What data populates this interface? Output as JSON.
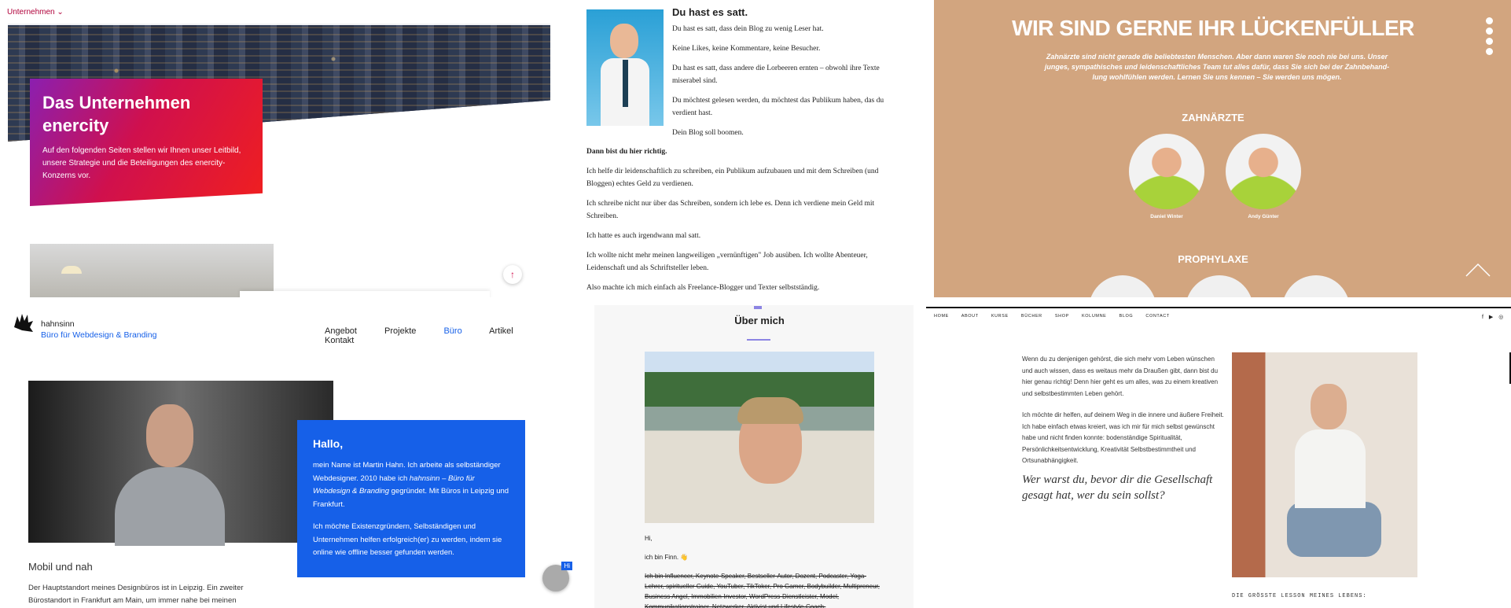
{
  "enercity": {
    "menu_label": "Unternehmen",
    "title_line1": "Das Unternehmen",
    "title_line2": "enercity",
    "text": "Auf den folgenden Seiten stellen wir Ihnen unser Leitbild, unsere Strategie und die Beteiligungen des enercity-Konzerns vor.",
    "accent": "#d0104d"
  },
  "blog": {
    "heading": "Du hast es satt.",
    "intro": [
      "Du hast es satt, dass dein Blog zu wenig Leser hat.",
      "Keine Likes, keine Kommentare, keine Besucher.",
      "Du hast es satt, dass andere die Lorbeeren ernten – obwohl ihre Texte miserabel sind.",
      "Du möchtest gelesen werden, du möchtest das Publikum haben, das du verdient hast.",
      "Dein Blog soll boomen."
    ],
    "bold_line": "Dann bist du hier richtig.",
    "body": [
      "Ich helfe dir leidenschaftlich zu schreiben, ein Publikum aufzubauen und mit dem Schreiben (und Bloggen) echtes Geld zu verdienen.",
      "Ich schreibe nicht nur über das Schreiben, sondern ich lebe es. Denn ich verdiene mein Geld mit Schreiben.",
      "Ich hatte es auch irgendwann mal satt.",
      "Ich wollte nicht mehr meinen langweiligen „vernünftigen\" Job ausüben. Ich wollte Abenteuer, Leidenschaft und als Schriftsteller leben.",
      "Also machte ich mich einfach als Freelance-Blogger und Texter selbstständig."
    ]
  },
  "dental": {
    "title": "WIR SIND GERNE IHR LÜCKENFÜLLER",
    "intro": "Zahnärzte sind nicht gerade die beliebtesten Menschen. Aber dann waren Sie noch nie bei uns. Unser junges, sympathisches und leidenschaftliches Team tut alles dafür, dass Sie sich bei der Zahnbehand-lung wohlfühlen werden. Lernen Sie uns kennen – Sie werden uns mögen.",
    "section1": "ZAHNÄRZTE",
    "dentists": [
      "Daniel Winter",
      "Andy Günter"
    ],
    "section2": "PROPHYLAXE",
    "bg": "#d2a57f"
  },
  "hahnsinn": {
    "brand": "hahnsinn",
    "brand_sub": "Büro für Webdesign & Branding",
    "nav": [
      "Angebot",
      "Projekte",
      "Büro",
      "Artikel",
      "Kontakt"
    ],
    "active_nav": "Büro",
    "greeting": "Hallo,",
    "p1_a": "mein Name ist Martin Hahn. Ich arbeite als selbständiger Webdesigner. 2010 habe ich ",
    "p1_em": "hahnsinn – Büro für Webdesign & Branding",
    "p1_b": " gegründet. Mit Büros in Leipzig und Frankfurt.",
    "p2": "Ich möchte Existenzgründern, Selbständigen und Unternehmen helfen erfolgreich(er) zu werden, indem sie online wie offline besser gefunden werden.",
    "subheading": "Mobil und nah",
    "body": "Der Hauptstandort meines Designbüros ist in Leipzig. Ein zweiter Bürostandort in Frankfurt am Main, um immer nahe bei meinen",
    "chat_badge": "Hi",
    "accent": "#1660e8"
  },
  "ueber": {
    "heading": "Über mich",
    "hi": "Hi,",
    "intro": "ich bin Finn. 👋",
    "struck": "Ich bin Influencer, Keynote-Speaker, Bestseller-Autor, Dozent, Podcaster, Yoga-Lehrer, spiritueller Guide, YouTuber, TikToker, Pro Gamer, Bodybuilder, Multipreneur, Business Angel, Immobilien-Investor, WordPress-Dienstleister, Model, Kommunikationstrainer, Netzwerker, Aktivist und Lifestyle-Coach.",
    "accent": "#8c84e3"
  },
  "coach": {
    "nav": [
      "HOME",
      "ABOUT",
      "KURSE",
      "BÜCHER",
      "SHOP",
      "KOLUMNE",
      "BLOG",
      "CONTACT"
    ],
    "social": [
      "f",
      "▶",
      "◎"
    ],
    "p1": "Wenn du zu denjenigen gehörst, die sich mehr vom Leben wünschen und auch wissen, dass es weitaus mehr da Draußen gibt, dann bist du hier genau richtig! Denn hier geht es um alles, was zu einem kreativen und selbstbestimmten Leben gehört.",
    "p2": "Ich möchte dir helfen, auf deinem Weg in die innere und äußere Freiheit. Ich habe einfach etwas kreiert, was ich mir für mich selbst gewünscht habe und nicht finden konnte: bodenständige Spiritualität, Persönlichkeitsentwicklung, Kreativität Selbstbestimmtheit und Ortsunabhängigkeit.",
    "quote": "Wer warst du, bevor dir die Gesellschaft gesagt hat, wer du sein sollst?",
    "lesson": "DIE GRÖSSTE LESSON MEINES LEBENS:"
  }
}
